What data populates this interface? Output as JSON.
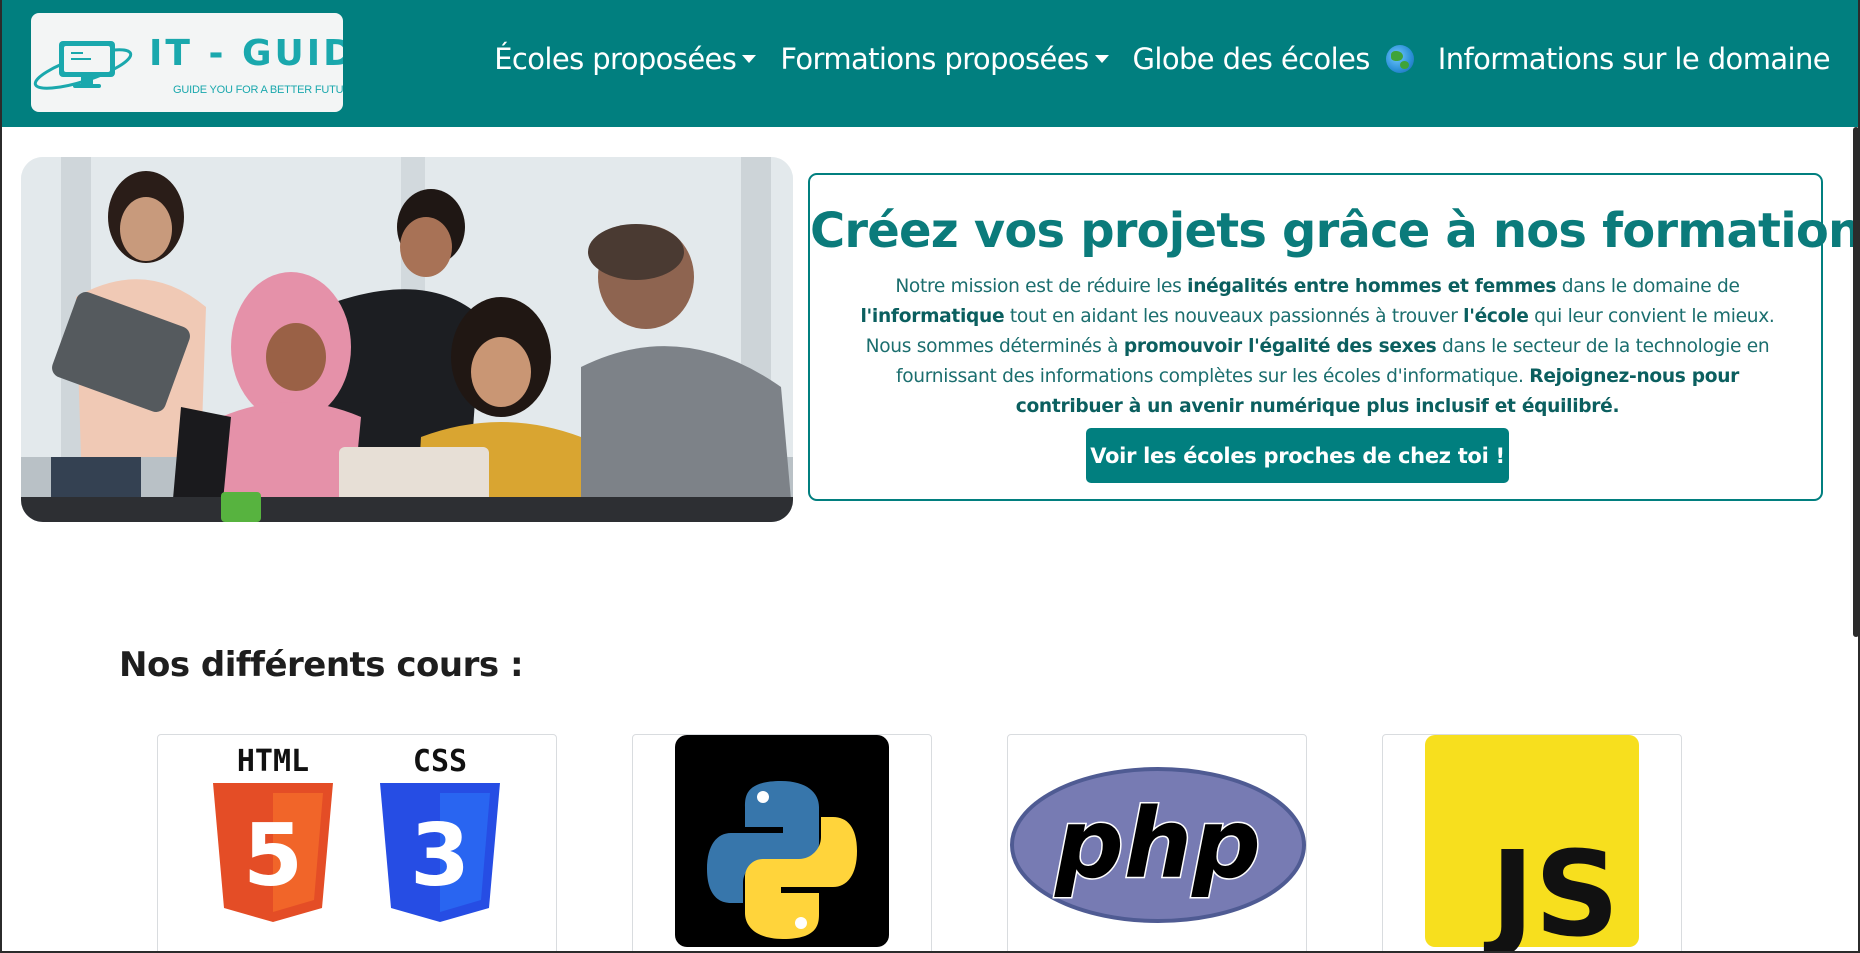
{
  "brand": {
    "name": "IT - GUIDE",
    "tagline": "GUIDE YOU FOR A BETTER FUTURE",
    "icon": "laptop-orbit-icon"
  },
  "nav": {
    "items": [
      {
        "label": "Écoles proposées",
        "dropdown": true
      },
      {
        "label": "Formations proposées",
        "dropdown": true
      },
      {
        "label": "Globe des écoles",
        "icon": "globe-icon"
      },
      {
        "label": "Informations sur le domaine"
      }
    ]
  },
  "hero": {
    "title": "Créez vos projets grâce à nos formations",
    "paragraph": [
      {
        "text": "Notre mission est de réduire les ",
        "bold": false
      },
      {
        "text": "inégalités entre hommes et femmes",
        "bold": true
      },
      {
        "text": " dans le domaine de ",
        "bold": false
      },
      {
        "text": "l'informatique",
        "bold": true
      },
      {
        "text": " tout en aidant les nouveaux passionnés à trouver ",
        "bold": false
      },
      {
        "text": "l'école",
        "bold": true
      },
      {
        "text": " qui leur convient le mieux. Nous sommes déterminés à ",
        "bold": false
      },
      {
        "text": "promouvoir l'égalité des sexes",
        "bold": true
      },
      {
        "text": " dans le secteur de la technologie en fournissant des informations complètes sur les écoles d'informatique. ",
        "bold": false
      },
      {
        "text": "Rejoignez-nous pour contribuer à un avenir numérique plus inclusif et équilibré.",
        "bold": true
      }
    ],
    "cta_label": "Voir les écoles proches de chez toi !"
  },
  "courses": {
    "heading": "Nos différents cours :",
    "items": [
      {
        "name": "html-css-logo",
        "labels": [
          "HTML",
          "CSS"
        ],
        "badges": [
          "5",
          "3"
        ]
      },
      {
        "name": "python-logo"
      },
      {
        "name": "php-logo",
        "label": "php"
      },
      {
        "name": "javascript-logo",
        "label": "JS"
      }
    ]
  },
  "colors": {
    "primary": "#017f7f",
    "brand_cyan": "#1aa8ad",
    "html_orange": "#e44d26",
    "css_blue": "#264de4",
    "php_purple": "#777bb3",
    "js_yellow": "#f7df1e"
  }
}
